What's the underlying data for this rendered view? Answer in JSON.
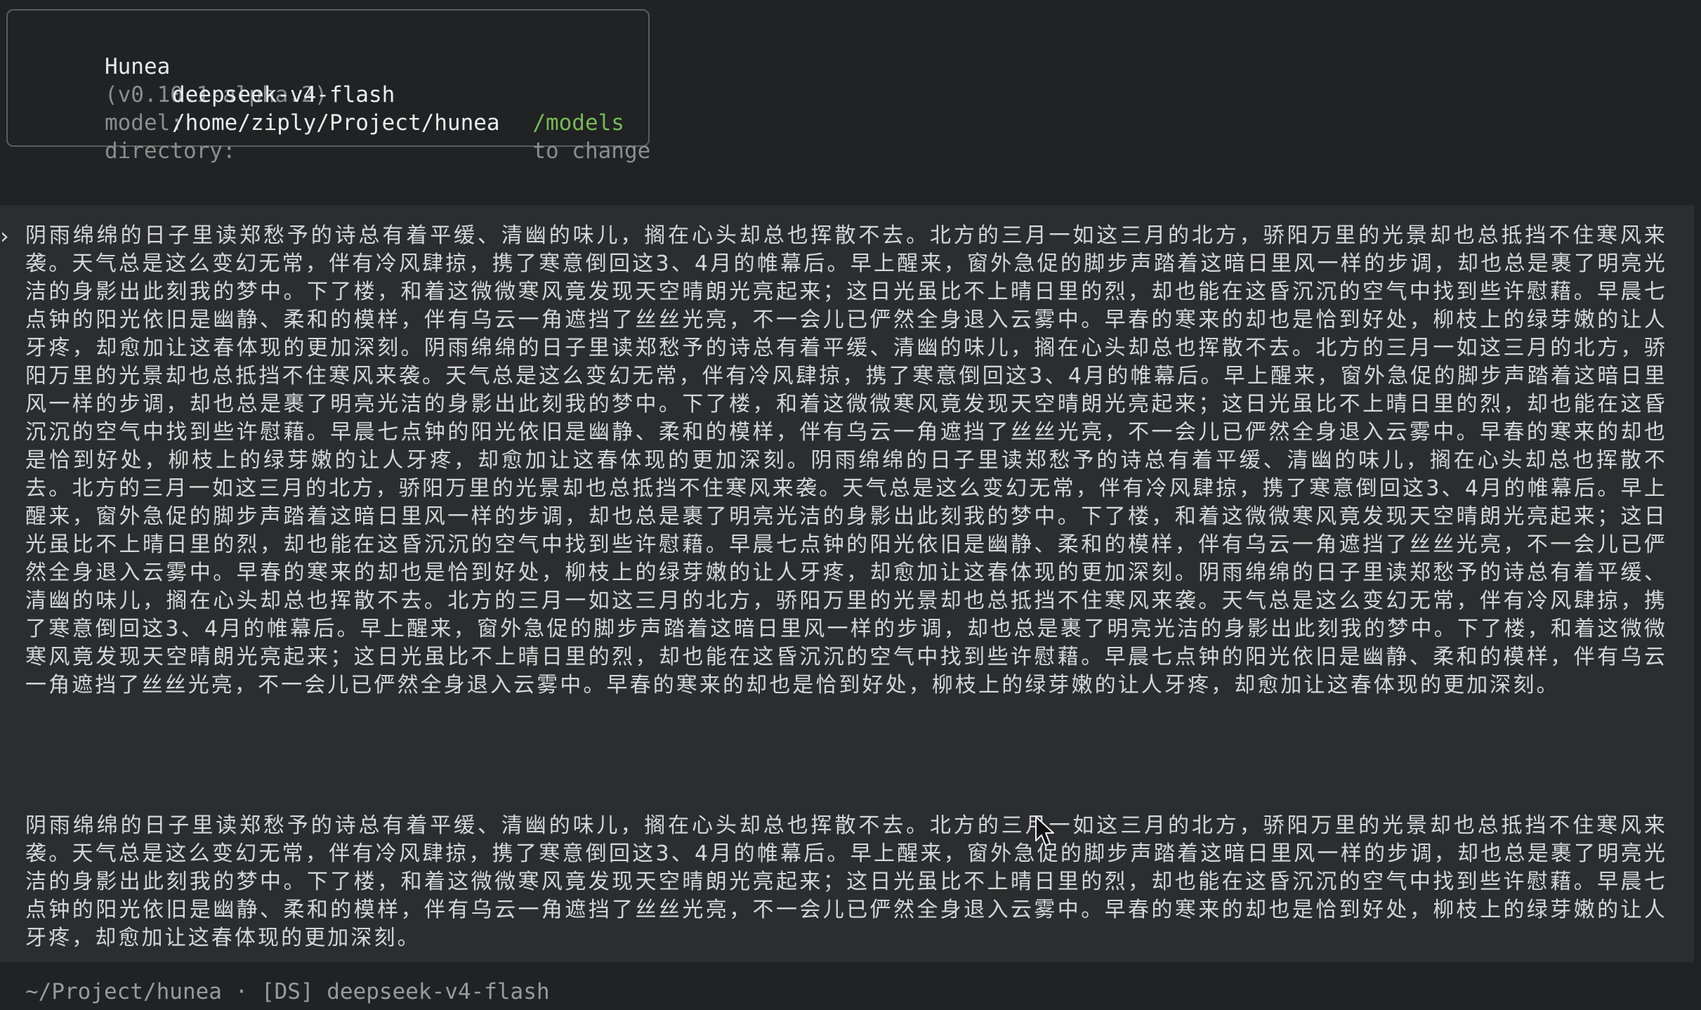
{
  "header": {
    "app_name": "Hunea",
    "version": "(v0.10.1-alpha.2)",
    "model_label": "model:",
    "model_value": "deepseek-v4-flash",
    "models_command": "/models",
    "change_text": "to change",
    "directory_label": "directory:",
    "directory_value": "/home/ziply/Project/hunea"
  },
  "message": {
    "prompt_icon": "chevron-right-icon",
    "paragraph_1": "阴雨绵绵的日子里读郑愁予的诗总有着平缓、清幽的味儿，搁在心头却总也挥散不去。北方的三月一如这三月的北方，骄阳万里的光景却也总抵挡不住寒风来袭。天气总是这么变幻无常，伴有冷风肆掠，携了寒意倒回这3、4月的帷幕后。早上醒来，窗外急促的脚步声踏着这暗日里风一样的步调，却也总是裹了明亮光洁的身影出此刻我的梦中。下了楼，和着这微微寒风竟发现天空晴朗光亮起来；这日光虽比不上晴日里的烈，却也能在这昏沉沉的空气中找到些许慰藉。早晨七点钟的阳光依旧是幽静、柔和的模样，伴有乌云一角遮挡了丝丝光亮，不一会儿已俨然全身退入云雾中。早春的寒来的却也是恰到好处，柳枝上的绿芽嫩的让人牙疼，却愈加让这春体现的更加深刻。阴雨绵绵的日子里读郑愁予的诗总有着平缓、清幽的味儿，搁在心头却总也挥散不去。北方的三月一如这三月的北方，骄阳万里的光景却也总抵挡不住寒风来袭。天气总是这么变幻无常，伴有冷风肆掠，携了寒意倒回这3、4月的帷幕后。早上醒来，窗外急促的脚步声踏着这暗日里风一样的步调，却也总是裹了明亮光洁的身影出此刻我的梦中。下了楼，和着这微微寒风竟发现天空晴朗光亮起来；这日光虽比不上晴日里的烈，却也能在这昏沉沉的空气中找到些许慰藉。早晨七点钟的阳光依旧是幽静、柔和的模样，伴有乌云一角遮挡了丝丝光亮，不一会儿已俨然全身退入云雾中。早春的寒来的却也是恰到好处，柳枝上的绿芽嫩的让人牙疼，却愈加让这春体现的更加深刻。阴雨绵绵的日子里读郑愁予的诗总有着平缓、清幽的味儿，搁在心头却总也挥散不去。北方的三月一如这三月的北方，骄阳万里的光景却也总抵挡不住寒风来袭。天气总是这么变幻无常，伴有冷风肆掠，携了寒意倒回这3、4月的帷幕后。早上醒来，窗外急促的脚步声踏着这暗日里风一样的步调，却也总是裹了明亮光洁的身影出此刻我的梦中。下了楼，和着这微微寒风竟发现天空晴朗光亮起来；这日光虽比不上晴日里的烈，却也能在这昏沉沉的空气中找到些许慰藉。早晨七点钟的阳光依旧是幽静、柔和的模样，伴有乌云一角遮挡了丝丝光亮，不一会儿已俨然全身退入云雾中。早春的寒来的却也是恰到好处，柳枝上的绿芽嫩的让人牙疼，却愈加让这春体现的更加深刻。阴雨绵绵的日子里读郑愁予的诗总有着平缓、清幽的味儿，搁在心头却总也挥散不去。北方的三月一如这三月的北方，骄阳万里的光景却也总抵挡不住寒风来袭。天气总是这么变幻无常，伴有冷风肆掠，携了寒意倒回这3、4月的帷幕后。早上醒来，窗外急促的脚步声踏着这暗日里风一样的步调，却也总是裹了明亮光洁的身影出此刻我的梦中。下了楼，和着这微微寒风竟发现天空晴朗光亮起来；这日光虽比不上晴日里的烈，却也能在这昏沉沉的空气中找到些许慰藉。早晨七点钟的阳光依旧是幽静、柔和的模样，伴有乌云一角遮挡了丝丝光亮，不一会儿已俨然全身退入云雾中。早春的寒来的却也是恰到好处，柳枝上的绿芽嫩的让人牙疼，却愈加让这春体现的更加深刻。",
    "paragraph_2": "阴雨绵绵的日子里读郑愁予的诗总有着平缓、清幽的味儿，搁在心头却总也挥散不去。北方的三月一如这三月的北方，骄阳万里的光景却也总抵挡不住寒风来袭。天气总是这么变幻无常，伴有冷风肆掠，携了寒意倒回这3、4月的帷幕后。早上醒来，窗外急促的脚步声踏着这暗日里风一样的步调，却也总是裹了明亮光洁的身影出此刻我的梦中。下了楼，和着这微微寒风竟发现天空晴朗光亮起来；这日光虽比不上晴日里的烈，却也能在这昏沉沉的空气中找到些许慰藉。早晨七点钟的阳光依旧是幽静、柔和的模样，伴有乌云一角遮挡了丝丝光亮，不一会儿已俨然全身退入云雾中。早春的寒来的却也是恰到好处，柳枝上的绿芽嫩的让人牙疼，却愈加让这春体现的更加深刻。"
  },
  "status": {
    "text": "~/Project/hunea · [DS] deepseek-v4-flash"
  },
  "icons": {
    "mouse_cursor": "mouse-pointer-icon"
  },
  "colors": {
    "background": "#202223",
    "message_background": "#2b2d2f",
    "border": "#5b5d60",
    "text": "#d8d8d8",
    "muted": "#8d8d8d",
    "accent": "#78b957"
  }
}
